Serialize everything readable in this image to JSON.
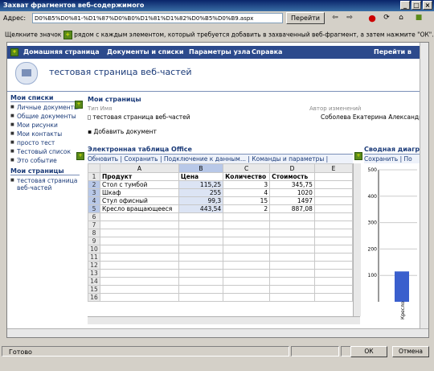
{
  "window": {
    "title": "Захват фрагментов веб-содержимого",
    "min_label": "_",
    "max_label": "□",
    "close_label": "×"
  },
  "address_bar": {
    "label": "Адрес:",
    "value": "D0%B5%D0%81-%D1%87%D0%B0%D1%81%D1%82%D0%B5%D0%B9.aspx",
    "go_label": "Перейти"
  },
  "hint": {
    "text_before": "Щелкните значок",
    "text_after": "рядом с каждым элементом, который требуется добавить в захваченный веб-фрагмент, а затем нажмите \"ОК\"."
  },
  "nav": {
    "home": "Домашняя страница",
    "docs": "Документы и списки",
    "settings": "Параметры узла",
    "help": "Справка",
    "goto": "Перейти в "
  },
  "page_title": "тестовая страница веб-частей",
  "sidebar": {
    "my_lists_heading": "Мои списки",
    "lists": [
      "Личные документы",
      "Общие документы",
      "Мои рисунки",
      "Мои контакты",
      "просто тест",
      "Тестовый список",
      "Это событие"
    ],
    "my_pages_heading": "Мои страницы",
    "pages": [
      "тестовая страница веб-частей"
    ]
  },
  "my_pages_section": {
    "heading": "Мои страницы",
    "col_type": "Тип",
    "col_name": "Имя",
    "page_name": "тестовая страница веб-частей",
    "col_author": "Автор изменений",
    "author": "Соболева Екатерина Александр",
    "add_doc": "Добавить документ"
  },
  "spreadsheet": {
    "heading": "Электронная таблица Office",
    "toolbar": "Обновить | Сохранить | Подключение к данным... | Команды и параметры |",
    "columns": [
      "A",
      "B",
      "C",
      "D",
      "E"
    ],
    "rows": [
      [
        "Продукт",
        "Цена",
        "Количество",
        "Стоимость",
        ""
      ],
      [
        "Стол с тумбой",
        "115,25",
        "3",
        "345,75",
        ""
      ],
      [
        "Шкаф",
        "255",
        "4",
        "1020",
        ""
      ],
      [
        "Стул офисный",
        "99,3",
        "15",
        "1497",
        ""
      ],
      [
        "Кресло вращающееся",
        "443,54",
        "2",
        "887,08",
        ""
      ],
      [
        "",
        "",
        "",
        "",
        ""
      ],
      [
        "",
        "",
        "",
        "",
        ""
      ],
      [
        "",
        "",
        "",
        "",
        ""
      ],
      [
        "",
        "",
        "",
        "",
        ""
      ],
      [
        "",
        "",
        "",
        "",
        ""
      ],
      [
        "",
        "",
        "",
        "",
        ""
      ],
      [
        "",
        "",
        "",
        "",
        ""
      ],
      [
        "",
        "",
        "",
        "",
        ""
      ],
      [
        "",
        "",
        "",
        "",
        ""
      ],
      [
        "",
        "",
        "",
        "",
        ""
      ],
      [
        "",
        "",
        "",
        "",
        ""
      ]
    ],
    "row_numbers": [
      "1",
      "2",
      "3",
      "4",
      "5",
      "6",
      "7",
      "8",
      "9",
      "10",
      "11",
      "12",
      "13",
      "14",
      "15",
      "16"
    ]
  },
  "pivot": {
    "heading": "Сводная диагр",
    "toolbar": "Сохранить | По",
    "axis_labels": [
      "500",
      "400",
      "300",
      "200",
      "100"
    ],
    "bar_label": "Кресло"
  },
  "chart_data": {
    "type": "bar",
    "categories": [
      "Кресло"
    ],
    "values": [
      115
    ],
    "ylim": [
      0,
      500
    ]
  },
  "status": {
    "text": "Готово",
    "ok_label": "ОК",
    "cancel_label": "Отмена"
  }
}
